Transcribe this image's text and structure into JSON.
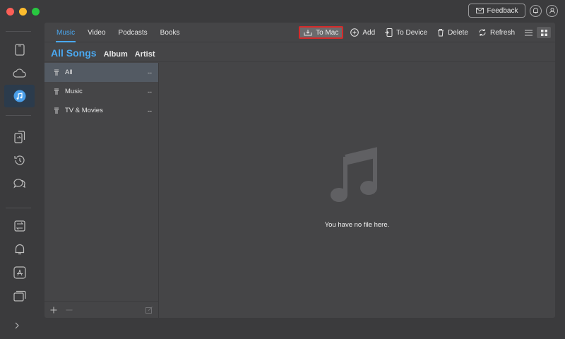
{
  "topbar": {
    "feedback_label": "Feedback"
  },
  "tabs": [
    {
      "label": "Music"
    },
    {
      "label": "Video"
    },
    {
      "label": "Podcasts"
    },
    {
      "label": "Books"
    }
  ],
  "actions": {
    "to_mac": "To Mac",
    "add": "Add",
    "to_device": "To Device",
    "delete": "Delete",
    "refresh": "Refresh"
  },
  "subnav": {
    "active": "All Songs",
    "album": "Album",
    "artist": "Artist"
  },
  "categories": [
    {
      "label": "All",
      "count": "--"
    },
    {
      "label": "Music",
      "count": "--"
    },
    {
      "label": "TV & Movies",
      "count": "--"
    }
  ],
  "empty_message": "You have no file here.",
  "colors": {
    "accent": "#4aa8f0",
    "highlight_border": "#d42b2b",
    "window_bg": "#3b3b3d",
    "panel_bg": "#454547"
  }
}
